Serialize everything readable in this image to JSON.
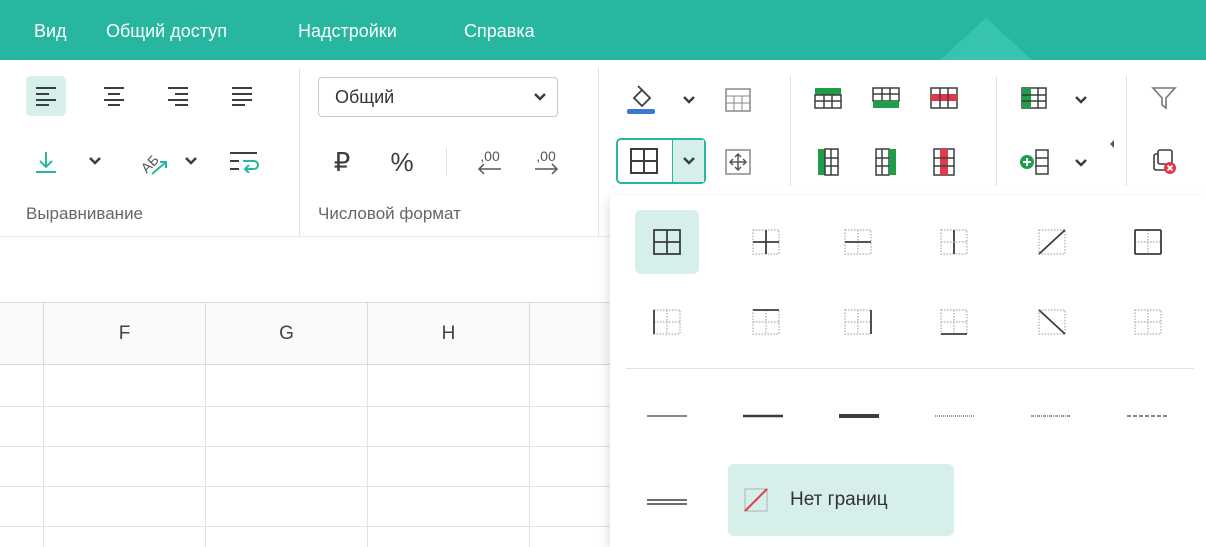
{
  "menu": {
    "items": [
      "Вид",
      "Общий доступ",
      "Надстройки",
      "Справка"
    ]
  },
  "ribbon": {
    "alignment": {
      "label": "Выравнивание",
      "buttons": [
        "align-left",
        "align-center",
        "align-right",
        "justify",
        "valign-bottom",
        "text-rotation",
        "wrap-text"
      ]
    },
    "number_format": {
      "label": "Числовой формат",
      "select_value": "Общий",
      "currency_symbol": "₽",
      "percent_symbol": "%",
      "decrease_decimals": ",00",
      "increase_decimals": ",00"
    }
  },
  "sheet": {
    "columns": [
      "F",
      "G",
      "H"
    ]
  },
  "border_panel": {
    "no_border_label": "Нет границ",
    "presets": [
      "all-borders",
      "inner-borders",
      "inner-horizontal",
      "inner-vertical",
      "diagonal-up",
      "right-border",
      "left-border",
      "top-border",
      "right-outer",
      "bottom-border",
      "diagonal-down",
      "no-lines"
    ],
    "line_styles": [
      "thin",
      "medium",
      "thick",
      "dotted",
      "dash-dot",
      "dashed",
      "double"
    ]
  },
  "colors": {
    "accent": "#27b7a0",
    "active_bg": "#d6efea",
    "icon": "#3d3d3d",
    "green": "#1f9d4a",
    "red": "#e03a4a",
    "fill_bar": "#3a78d4"
  }
}
